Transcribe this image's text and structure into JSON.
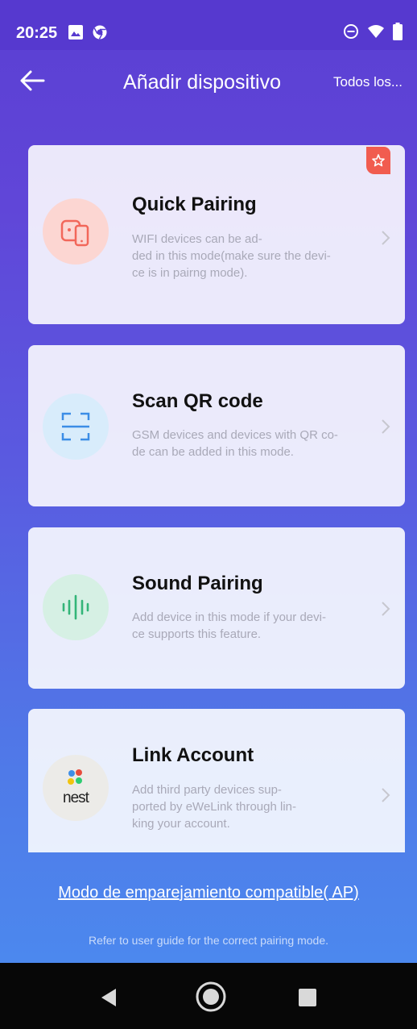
{
  "status_bar": {
    "time": "20:25",
    "icons": [
      "image-icon",
      "chrome-icon",
      "do-not-disturb-icon",
      "wifi-icon",
      "battery-icon"
    ]
  },
  "header": {
    "title": "Añadir dispositivo",
    "action_label": "Todos los...",
    "back_icon": "back-arrow-icon"
  },
  "cards": [
    {
      "title": "Quick Pairing",
      "description": "WIFI devices can be ad-\nded in this mode(make sure the devi-\nce is in pairng mode).",
      "icon": "phone-device-icon",
      "icon_bg": "#fcd6d2",
      "icon_color": "#f2675a",
      "badge_icon": "star-icon"
    },
    {
      "title": "Scan QR code",
      "description": "GSM devices and devices with QR co-\nde can be added in this mode.",
      "icon": "scan-frame-icon",
      "icon_bg": "#d8ecfb",
      "icon_color": "#3b8de6"
    },
    {
      "title": "Sound Pairing",
      "description": "Add device in this mode if your devi-\nce supports this feature.",
      "icon": "sound-wave-icon",
      "icon_bg": "#d6f0e4",
      "icon_color": "#33b578"
    },
    {
      "title": "Link Account",
      "description": "Add third party devices sup-\nported by eWeLink through lin-\nking your account.",
      "icon": "nest-logo-icon",
      "icon_bg": "#ecebe8",
      "logo_text": "nest"
    }
  ],
  "footer": {
    "compat_link": "Modo de emparejamiento compatible( AP)",
    "hint": "Refer to user guide for the correct pairing mode."
  },
  "nav": {
    "icons": [
      "back-triangle-icon",
      "home-circle-icon",
      "recents-square-icon"
    ]
  }
}
